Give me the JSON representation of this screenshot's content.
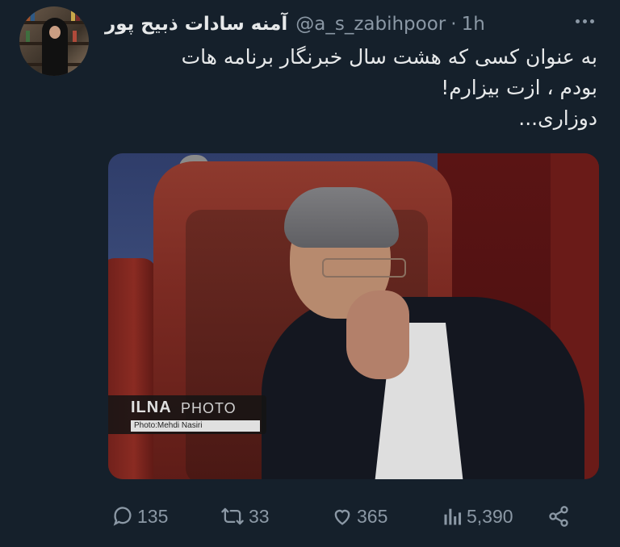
{
  "tweet": {
    "author": {
      "display_name": "آمنه سادات ذبیح پور",
      "handle": "@a_s_zabihpoor",
      "separator": "·",
      "time": "1h"
    },
    "text_lines": [
      "به عنوان کسی که هشت سال خبرنگار برنامه هات",
      "بودم ، ازت بیزارم!",
      "دوزاری..."
    ],
    "media": {
      "watermark_brand": "ILNA",
      "watermark_label": "PHOTO",
      "watermark_credit": "Photo:Mehdi Nasiri"
    },
    "actions": {
      "replies": "135",
      "retweets": "33",
      "likes": "365",
      "views": "5,390"
    }
  },
  "icons": {
    "more": "more-icon",
    "reply": "reply-icon",
    "retweet": "retweet-icon",
    "like": "heart-icon",
    "views": "views-icon",
    "share": "share-icon"
  },
  "colors": {
    "background": "#15202b",
    "text": "#e7e9ea",
    "muted": "#8b98a5"
  }
}
